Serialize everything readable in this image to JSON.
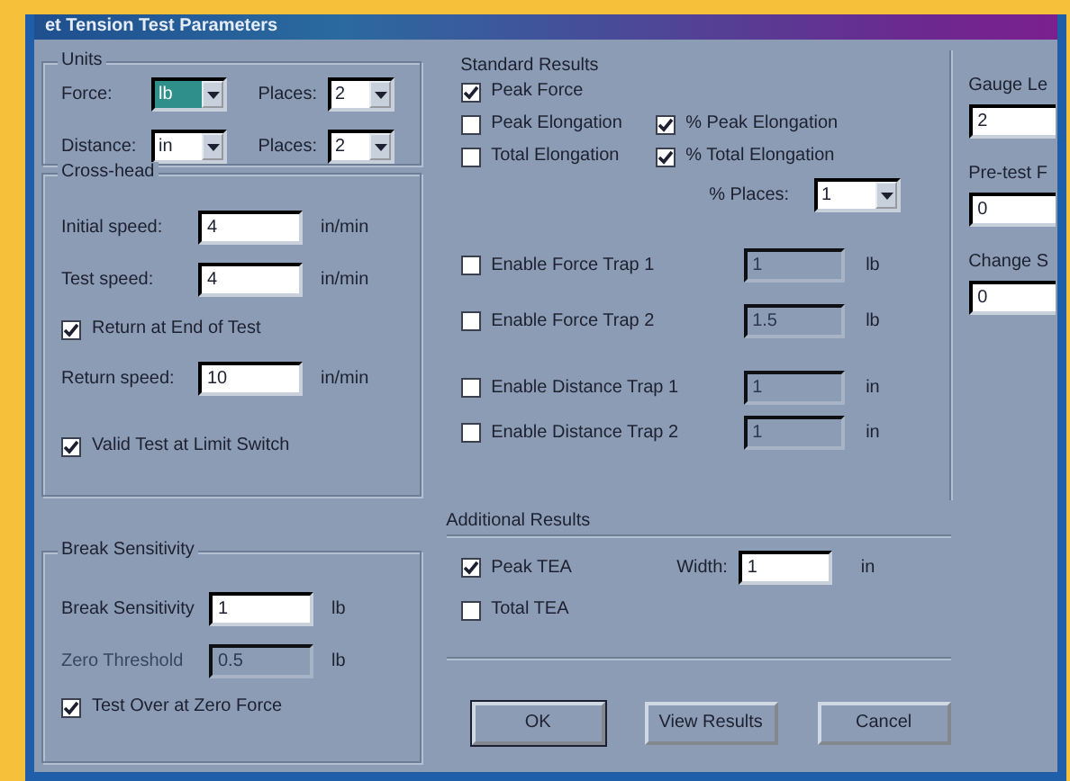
{
  "window": {
    "title": "et Tension Test Parameters"
  },
  "units": {
    "label": "Units",
    "rows": [
      {
        "label": "Force:",
        "value": "lb",
        "selected": true,
        "places_label": "Places:",
        "places": "2"
      },
      {
        "label": "Distance:",
        "value": "in",
        "selected": false,
        "places_label": "Places:",
        "places": "2"
      }
    ]
  },
  "crosshead": {
    "label": "Cross-head",
    "items": [
      {
        "kind": "field",
        "label": "Initial speed:",
        "value": "4",
        "unit": "in/min",
        "disabled": false
      },
      {
        "kind": "field",
        "label": "Test speed:",
        "value": "4",
        "unit": "in/min",
        "disabled": false
      },
      {
        "kind": "check",
        "label": "Return at End of Test",
        "checked": true
      },
      {
        "kind": "field",
        "label": "Return speed:",
        "value": "10",
        "unit": "in/min",
        "disabled": false
      },
      {
        "kind": "check",
        "label": "Valid Test at Limit Switch",
        "checked": true
      }
    ]
  },
  "break_sensitivity": {
    "label": "Break Sensitivity",
    "items": [
      {
        "kind": "field",
        "label": "Break Sensitivity",
        "value": "1",
        "unit": "lb",
        "disabled": false
      },
      {
        "kind": "field",
        "label": "Zero Threshold",
        "value": "0.5",
        "unit": "lb",
        "disabled": true
      },
      {
        "kind": "check",
        "label": "Test Over at Zero Force",
        "checked": true
      }
    ]
  },
  "standard_results": {
    "label": "Standard Results",
    "rows": [
      {
        "items": [
          {
            "label": "Peak Force",
            "checked": true
          }
        ]
      },
      {
        "items": [
          {
            "label": "Peak Elongation",
            "checked": false
          },
          {
            "label": "% Peak Elongation",
            "checked": true
          }
        ]
      },
      {
        "items": [
          {
            "label": "Total Elongation",
            "checked": false
          },
          {
            "label": "% Total Elongation",
            "checked": true
          }
        ]
      }
    ],
    "places": {
      "label": "% Places:",
      "value": "1"
    }
  },
  "traps": [
    {
      "label": "Enable Force Trap 1",
      "checked": false,
      "value": "1",
      "unit": "lb",
      "disabled": true
    },
    {
      "label": "Enable Force Trap 2",
      "checked": false,
      "value": "1.5",
      "unit": "lb",
      "disabled": true
    },
    {
      "label": "Enable Distance Trap 1",
      "checked": false,
      "value": "1",
      "unit": "in",
      "disabled": true
    },
    {
      "label": "Enable Distance Trap 2",
      "checked": false,
      "value": "1",
      "unit": "in",
      "disabled": true
    }
  ],
  "additional_results": {
    "label": "Additional Results",
    "items": [
      {
        "label": "Peak TEA",
        "checked": true
      },
      {
        "label": "Total TEA",
        "checked": false
      }
    ],
    "width": {
      "label": "Width:",
      "value": "1",
      "unit": "in"
    }
  },
  "buttons": [
    {
      "label": "OK",
      "default": true
    },
    {
      "label": "View Results",
      "default": false
    },
    {
      "label": "Cancel",
      "default": false
    }
  ],
  "right_fields": [
    {
      "label": "Gauge Le",
      "value": "2"
    },
    {
      "label": "Pre-test F",
      "value": "0"
    },
    {
      "label": "Change S",
      "value": "0"
    }
  ]
}
